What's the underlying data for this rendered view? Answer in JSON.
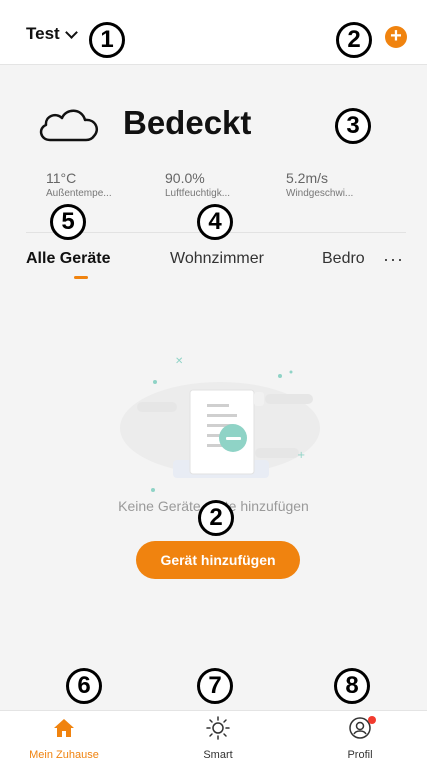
{
  "header": {
    "home_name": "Test",
    "chevron_icon": "chevron-down-icon",
    "add_icon": "plus-circle-icon",
    "add_symbol": "+"
  },
  "weather": {
    "icon": "cloud-icon",
    "condition": "Bedeckt",
    "metrics": [
      {
        "value": "11°C",
        "label": "Außentempe..."
      },
      {
        "value": "90.0%",
        "label": "Luftfeuchtigk..."
      },
      {
        "value": "5.2m/s",
        "label": "Windgeschwi..."
      }
    ]
  },
  "tabs": {
    "items": [
      "Alle Geräte",
      "Wohnzimmer",
      "Bedro"
    ],
    "more": "···"
  },
  "empty_state": {
    "message": "Keine Geräte. Bitte hinzufügen",
    "button": "Gerät hinzufügen"
  },
  "bottom_nav": [
    {
      "label": "Mein Zuhause",
      "icon": "home-icon",
      "active": true
    },
    {
      "label": "Smart",
      "icon": "sun-icon",
      "active": false
    },
    {
      "label": "Profil",
      "icon": "profile-icon",
      "active": false,
      "notification": true
    }
  ],
  "annotations": [
    "1",
    "2",
    "2",
    "3",
    "4",
    "5",
    "6",
    "7",
    "8"
  ],
  "colors": {
    "accent": "#f0830f",
    "notification": "#f23b2f",
    "illustration": "#8fd3c6"
  }
}
